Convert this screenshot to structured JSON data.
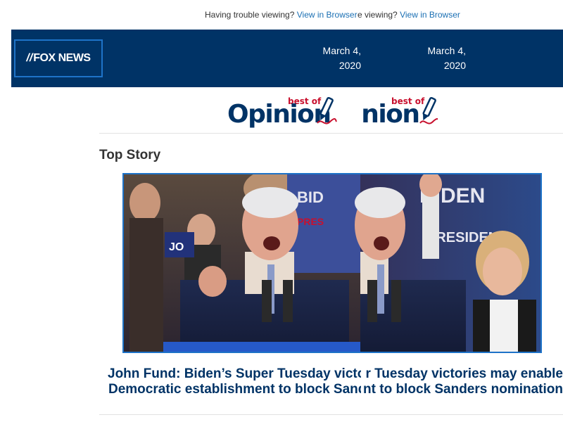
{
  "preheader": {
    "text": "Having trouble viewing?",
    "link": "View in Browser",
    "text_dup": "viewing?",
    "link_dup": "View in Browser"
  },
  "header": {
    "logo": "FOX NEWS",
    "date_line1": "March 4,",
    "date_line2": "2020"
  },
  "banner": {
    "best_of": "best of",
    "opinion": "Opinion",
    "opinion_partial": "inion"
  },
  "section": {
    "title": "Top Story"
  },
  "story": {
    "headline_line1": "John Fund: Biden’s Super Tuesday victories may enable",
    "headline_line2": "Democratic establishment to block Sanders nomination",
    "headline_line1_a": "John Fund: Biden’s Super Tuesday victor",
    "headline_line2_a": "Democratic establishment to block Sand",
    "headline_line1_b": "r Tuesday victories may enable",
    "headline_line2_b": "nt to block Sanders nomination"
  },
  "colors": {
    "header_bg": "#003366",
    "link": "#1a6fb3",
    "headline": "#003366",
    "frame": "#1e73c8",
    "best_of": "#c8102e"
  }
}
